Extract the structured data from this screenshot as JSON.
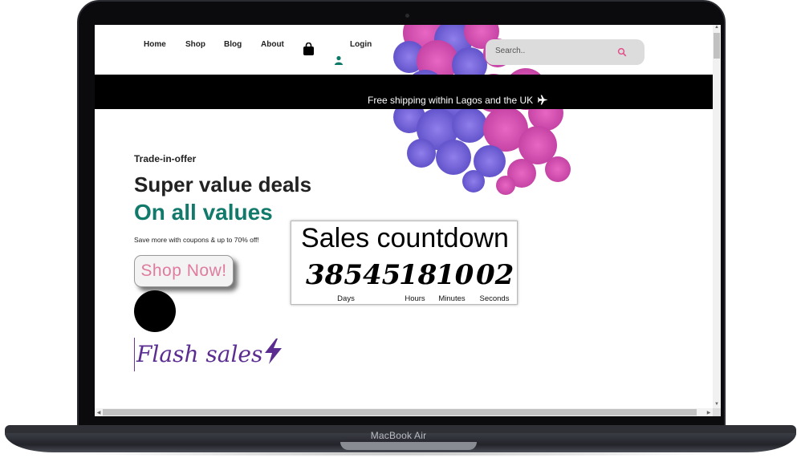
{
  "device": {
    "brand_label": "MacBook Air"
  },
  "nav": {
    "links": [
      "Home",
      "Shop",
      "Blog",
      "About"
    ],
    "cart_icon": "shopping-bag-icon",
    "login_icon": "user-icon",
    "login_label": "Login"
  },
  "search": {
    "placeholder": "Search..",
    "icon": "search-icon"
  },
  "banner": {
    "text": "Free shipping within Lagos and the UK",
    "icon": "airplane-icon"
  },
  "hero": {
    "kicker": "Trade-in-offer",
    "headline": "Super value deals",
    "subheadline": "On all values",
    "description": "Save more with coupons & up to 70% off!",
    "cta_label": "Shop Now!",
    "flash_label": "Flash sales",
    "flash_icon": "lightning-icon"
  },
  "countdown": {
    "title": "Sales countdown",
    "days": "38545",
    "hours": "18",
    "minutes": "10",
    "seconds": "02",
    "days_label": "Days",
    "hours_label": "Hours",
    "minutes_label": "Minutes",
    "seconds_label": "Seconds"
  },
  "colors": {
    "accent_green": "#117a6b",
    "cta_pink": "#e07ba0",
    "flash_purple": "#5b2d90",
    "banner_bg": "#000000"
  }
}
